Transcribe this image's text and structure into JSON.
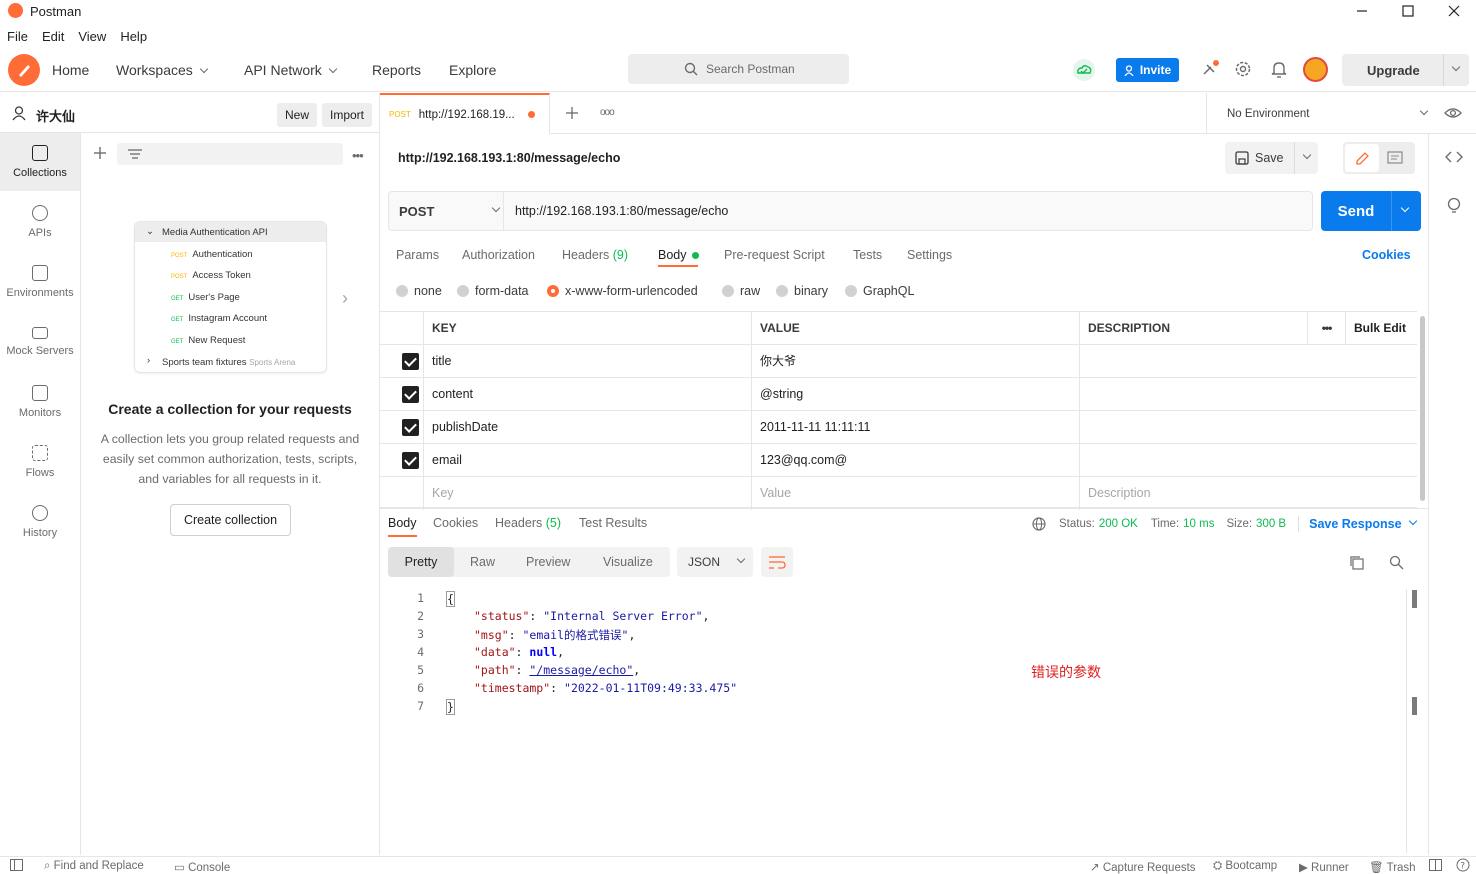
{
  "window": {
    "title": "Postman"
  },
  "menu": [
    "File",
    "Edit",
    "View",
    "Help"
  ],
  "header": {
    "home": "Home",
    "workspaces": "Workspaces",
    "api_network": "API Network",
    "reports": "Reports",
    "explore": "Explore",
    "search_placeholder": "Search Postman",
    "invite": "Invite",
    "upgrade": "Upgrade",
    "brand_color": "#ff6c37",
    "accent_color": "#097bed"
  },
  "sidebar": {
    "user": "许大仙",
    "new_btn": "New",
    "import_btn": "Import",
    "nav": [
      {
        "label": "Collections",
        "icon": "collections-icon",
        "active": true
      },
      {
        "label": "APIs",
        "icon": "apis-icon"
      },
      {
        "label": "Environments",
        "icon": "environments-icon"
      },
      {
        "label": "Mock Servers",
        "icon": "mock-servers-icon"
      },
      {
        "label": "Monitors",
        "icon": "monitors-icon"
      },
      {
        "label": "Flows",
        "icon": "flows-icon"
      },
      {
        "label": "History",
        "icon": "history-icon"
      }
    ],
    "illustration": {
      "folder": "Media Authentication API",
      "items": [
        {
          "method": "POST",
          "name": "Authentication"
        },
        {
          "method": "POST",
          "name": "Access Token"
        },
        {
          "method": "GET",
          "name": "User's Page"
        },
        {
          "method": "GET",
          "name": "Instagram Account"
        },
        {
          "method": "GET",
          "name": "New Request"
        }
      ],
      "folder2": "Sports team fixtures",
      "folder2_tag": "Sports Arena"
    },
    "empty_title": "Create a collection for your requests",
    "empty_desc_1": "A collection lets you group related requests and",
    "empty_desc_2": "easily set common authorization, tests, scripts,",
    "empty_desc_3": "and variables for all requests in it.",
    "create_btn": "Create collection"
  },
  "tabs": {
    "active_method": "POST",
    "active_url": "http://192.168.19...",
    "environment": "No Environment"
  },
  "request": {
    "title": "http://192.168.193.1:80/message/echo",
    "save": "Save",
    "method": "POST",
    "url": "http://192.168.193.1:80/message/echo",
    "send": "Send",
    "tabs": [
      "Params",
      "Authorization",
      "Headers",
      "(9)",
      "Body",
      "Pre-request Script",
      "Tests",
      "Settings"
    ],
    "cookies": "Cookies",
    "body_types": [
      "none",
      "form-data",
      "x-www-form-urlencoded",
      "raw",
      "binary",
      "GraphQL"
    ],
    "table": {
      "headers": {
        "key": "KEY",
        "value": "VALUE",
        "description": "DESCRIPTION",
        "bulk_edit": "Bulk Edit"
      },
      "rows": [
        {
          "key": "title",
          "value": "你大爷"
        },
        {
          "key": "content",
          "value": "@string"
        },
        {
          "key": "publishDate",
          "value": "2011-11-11 11:11:11"
        },
        {
          "key": "email",
          "value": "123@qq.com@"
        }
      ],
      "placeholder": {
        "key": "Key",
        "value": "Value",
        "description": "Description"
      }
    }
  },
  "response": {
    "tabs": [
      "Body",
      "Cookies",
      "Headers",
      "(5)",
      "Test Results"
    ],
    "status_label": "Status:",
    "status": "200 OK",
    "time_label": "Time:",
    "time": "10 ms",
    "size_label": "Size:",
    "size": "300 B",
    "save_response": "Save Response",
    "formats": [
      "Pretty",
      "Raw",
      "Preview",
      "Visualize"
    ],
    "lang": "JSON",
    "lines": [
      "1",
      "2",
      "3",
      "4",
      "5",
      "6",
      "7"
    ],
    "code": {
      "open": "{",
      "k_status": "\"status\"",
      "v_status": "\"Internal Server Error\"",
      "k_msg": "\"msg\"",
      "v_msg": "\"email的格式错误\"",
      "k_data": "\"data\"",
      "v_data": "null",
      "k_path": "\"path\"",
      "v_path": "\"/message/echo\"",
      "k_ts": "\"timestamp\"",
      "v_ts": "\"2022-01-11T09:49:33.475\"",
      "close": "}"
    },
    "annotation": "错误的参数"
  },
  "footer": {
    "find_replace": "Find and Replace",
    "console": "Console",
    "capture": "Capture Requests",
    "bootcamp": "Bootcamp",
    "runner": "Runner",
    "trash": "Trash"
  }
}
